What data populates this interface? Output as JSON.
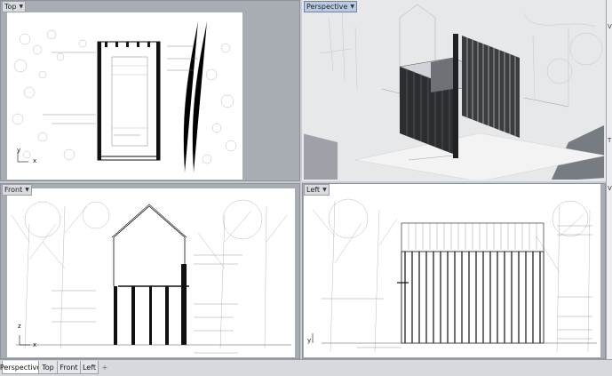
{
  "viewports": {
    "top": {
      "label": "Top"
    },
    "perspective": {
      "label": "Perspective"
    },
    "front": {
      "label": "Front"
    },
    "left": {
      "label": "Left"
    }
  },
  "tabs": [
    {
      "label": "Perspective"
    },
    {
      "label": "Top"
    },
    {
      "label": "Front"
    },
    {
      "label": "Left"
    }
  ],
  "add_tab_label": "+",
  "axis_labels": {
    "x": "x",
    "y": "y",
    "z": "z"
  },
  "right_panel": {
    "letters": [
      "V",
      "T",
      "V"
    ]
  },
  "colors": {
    "viewport_bg": "#a8acb3",
    "active_title": "#b8cbe3",
    "sheet": "#ffffff"
  }
}
